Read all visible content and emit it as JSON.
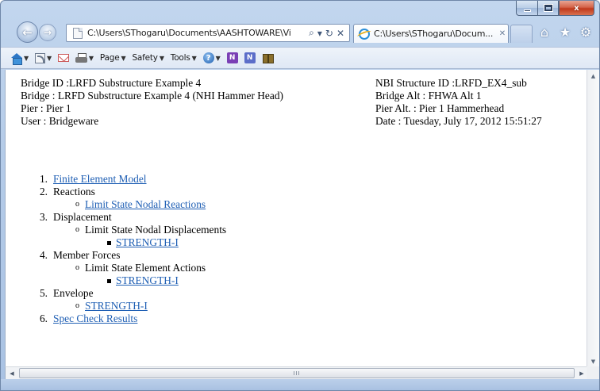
{
  "window": {
    "caption": {
      "minimize": "",
      "maximize": "",
      "close": "x"
    }
  },
  "nav": {
    "address": "C:\\Users\\SThogaru\\Documents\\AASHTOWARE\\Vi",
    "search_glyph": "⌕",
    "dropdown_glyph": "▾",
    "refresh_glyph": "↻",
    "stop_glyph": "✕",
    "tab_title": "C:\\Users\\SThogaru\\Docum...",
    "tab_close": "✕",
    "home_glyph": "⌂",
    "favorites_glyph": "★",
    "tools_glyph": "⚙"
  },
  "command_bar": {
    "page_label": "Page",
    "safety_label": "Safety",
    "tools_label": "Tools",
    "help_glyph": "?",
    "n1": "N",
    "n2": "N"
  },
  "header": {
    "left": [
      "Bridge ID :LRFD Substructure Example 4",
      "Bridge : LRFD Substructure Example 4 (NHI Hammer Head)",
      "Pier : Pier 1",
      "User : Bridgeware"
    ],
    "right": [
      "NBI Structure ID :LRFD_EX4_sub",
      "Bridge Alt : FHWA Alt 1",
      "Pier Alt. : Pier 1 Hammerhead",
      "Date : Tuesday, July 17, 2012 15:51:27"
    ]
  },
  "toc": {
    "item1": {
      "num": "1.",
      "label": "Finite Element Model"
    },
    "item2": {
      "num": "2.",
      "label": "Reactions",
      "sub": "Limit State Nodal Reactions"
    },
    "item3": {
      "num": "3.",
      "label": "Displacement",
      "sub": "Limit State Nodal Displacements",
      "subsub": "STRENGTH-I"
    },
    "item4": {
      "num": "4.",
      "label": "Member Forces",
      "sub": "Limit State Element Actions",
      "subsub": "STRENGTH-I"
    },
    "item5": {
      "num": "5.",
      "label": "Envelope",
      "sub": "STRENGTH-I"
    },
    "item6": {
      "num": "6.",
      "label": "Spec Check Results"
    },
    "circle_bullet": "o"
  },
  "scroll": {
    "up": "▲",
    "down": "▼",
    "left": "◀",
    "right": "▶",
    "grip": "III"
  }
}
